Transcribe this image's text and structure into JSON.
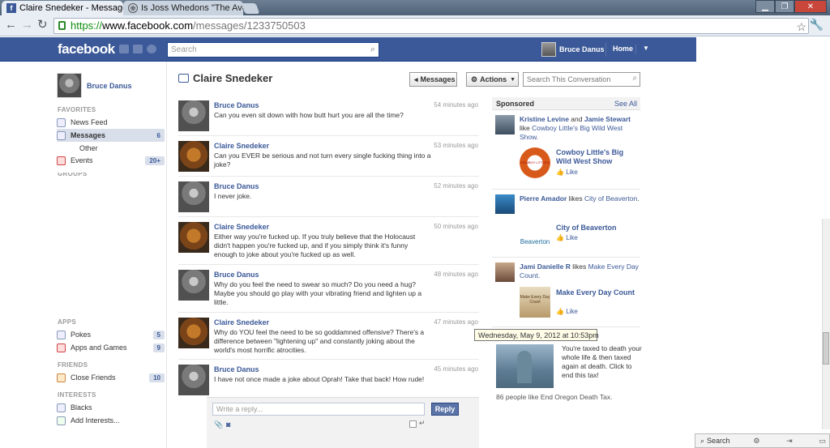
{
  "browser": {
    "tabs": [
      {
        "title": "Claire Snedeker - Messages"
      },
      {
        "title": "Is Joss Whedons \"The Aven"
      }
    ],
    "url": {
      "scheme": "https://",
      "host": "www.facebook.com",
      "path": "/messages/1233750503"
    }
  },
  "header": {
    "logo": "facebook",
    "search_placeholder": "Search",
    "user_name": "Bruce Danus",
    "home_label": "Home"
  },
  "sidebar": {
    "profile_name": "Bruce Danus",
    "favorites_label": "FAVORITES",
    "favorites": [
      {
        "label": "News Feed",
        "count": ""
      },
      {
        "label": "Messages",
        "count": "6"
      },
      {
        "label": "Other",
        "count": ""
      },
      {
        "label": "Events",
        "count": "20+"
      }
    ],
    "groups_label": "GROUPS",
    "apps_label": "APPS",
    "apps": [
      {
        "label": "Pokes",
        "count": "5"
      },
      {
        "label": "Apps and Games",
        "count": "9"
      }
    ],
    "friends_label": "FRIENDS",
    "friends": [
      {
        "label": "Close Friends",
        "count": "10"
      }
    ],
    "interests_label": "INTERESTS",
    "interests": [
      {
        "label": "Blacks"
      },
      {
        "label": "Add Interests..."
      }
    ]
  },
  "conversation": {
    "title": "Claire Snedeker",
    "messages_button": "Messages",
    "actions_button": "Actions",
    "search_placeholder": "Search This Conversation",
    "messages": [
      {
        "from": "Bruce Danus",
        "time": "54 minutes ago",
        "text": "Can you even sit down with how butt hurt you are all the time?"
      },
      {
        "from": "Claire Snedeker",
        "time": "53 minutes ago",
        "text": "Can you EVER be serious and not turn every single fucking thing into a joke?"
      },
      {
        "from": "Bruce Danus",
        "time": "52 minutes ago",
        "text": "I never joke."
      },
      {
        "from": "Claire Snedeker",
        "time": "50 minutes ago",
        "text": "Either way you're fucked up. If you truly believe that the Holocaust didn't happen you're fucked up, and if you simply think it's funny enough to joke about you're fucked up as well."
      },
      {
        "from": "Bruce Danus",
        "time": "48 minutes ago",
        "text": "Why do you feel the need to swear so much? Do you need a hug? Maybe you should go play with your vibrating friend and lighten up a little."
      },
      {
        "from": "Claire Snedeker",
        "time": "47 minutes ago",
        "text": "Why do YOU feel the need to be so goddamned offensive? There's a difference between \"lightening up\" and constantly joking about the world's most horrific atrocities."
      },
      {
        "from": "Bruce Danus",
        "time": "45 minutes ago",
        "text": "I have not once made a joke about Oprah! Take that back! How rude!"
      }
    ],
    "reply_placeholder": "Write a reply...",
    "reply_button": "Reply",
    "tooltip": "Wednesday, May 9, 2012 at 10:53pm"
  },
  "sponsored": {
    "heading": "Sponsored",
    "see_all": "See All",
    "ads": [
      {
        "who1": "Kristine Levine",
        "and": " and ",
        "who2": "Jamie Stewart",
        "likes": " like ",
        "page": "Cowboy Little's Big Wild West Show",
        "end": ".",
        "title": "Cowboy Little's Big Wild West Show",
        "like": "Like",
        "logo_text": "COWBOY LITTLE'S BIG"
      },
      {
        "who1": "Pierre Amador",
        "likes": " likes ",
        "page": "City of Beaverton",
        "end": ".",
        "title": "City of Beaverton",
        "like": "Like",
        "logo_text": "Beaverton"
      },
      {
        "who1": "Jami Danielle R",
        "likes": " likes ",
        "page": "Make Every Day Count",
        "end": ".",
        "title": "Make Every Day Count",
        "like": "Like",
        "logo_text": "Make Every Day Count"
      }
    ],
    "tax_ad": {
      "text": "You're taxed to death your whole life & then taxed again at death. Click to end this tax!",
      "footer": "86 people like End Oregon Death Tax."
    }
  },
  "chat": {
    "search_label": "Search"
  },
  "colors": {
    "fb_blue": "#3b5998",
    "link": "#3b5998",
    "reply_button": "#5b74a8"
  }
}
